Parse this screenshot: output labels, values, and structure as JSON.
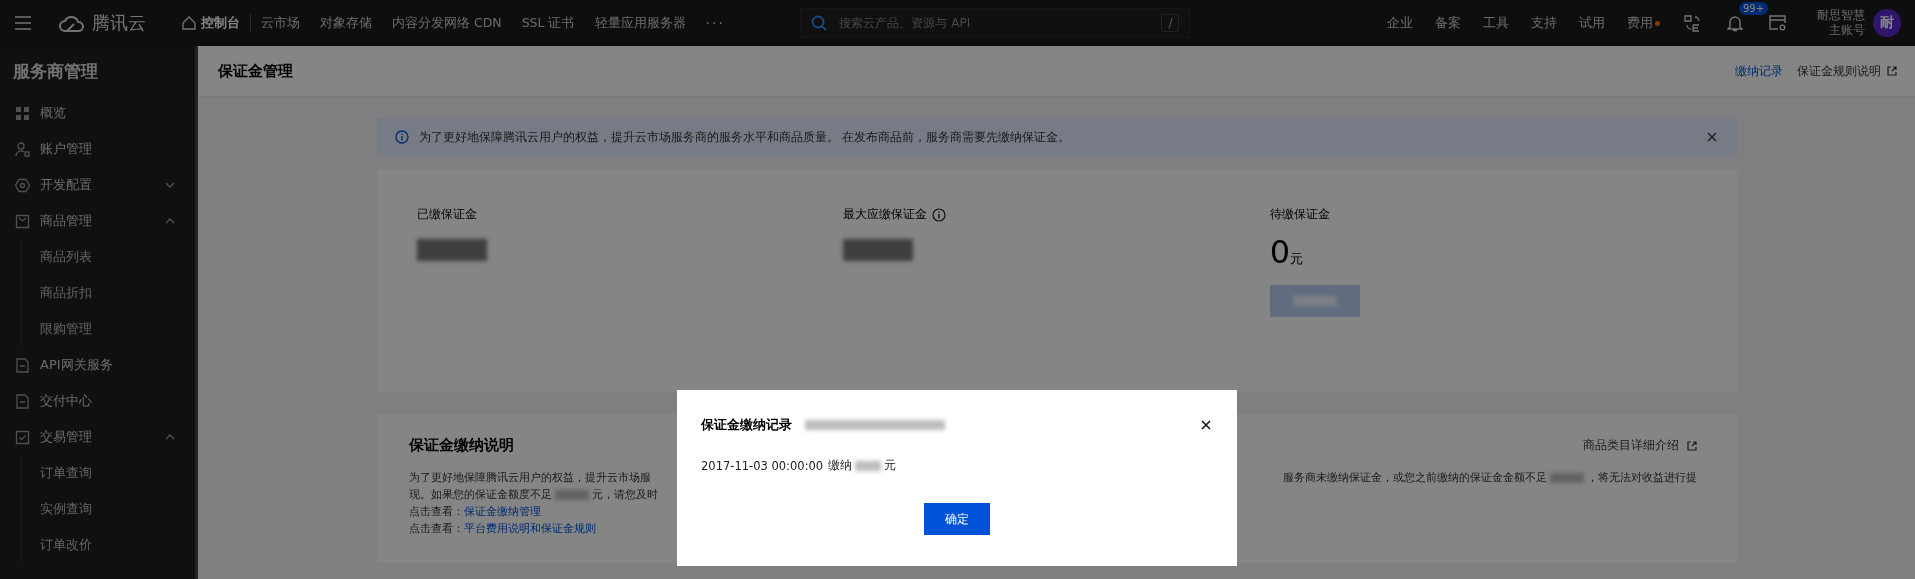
{
  "topbar": {
    "logo": "腾讯云",
    "nav": [
      {
        "label": "控制台",
        "selected": true
      },
      {
        "label": "云市场",
        "selected": false
      },
      {
        "label": "对象存储",
        "selected": false
      },
      {
        "label": "内容分发网络 CDN",
        "selected": false
      },
      {
        "label": "SSL 证书",
        "selected": false
      },
      {
        "label": "轻量应用服务器",
        "selected": false
      }
    ],
    "more": "···",
    "search": {
      "placeholder": "搜索云产品、资源与 API",
      "shortcut": "/"
    },
    "links": [
      {
        "label": "企业",
        "dot": false
      },
      {
        "label": "备案",
        "dot": false
      },
      {
        "label": "工具",
        "dot": false
      },
      {
        "label": "支持",
        "dot": false
      },
      {
        "label": "试用",
        "dot": false
      },
      {
        "label": "费用",
        "dot": true
      }
    ],
    "notifications": "99+",
    "account": {
      "name": "耐思智慧",
      "role": "主账号",
      "avatar": "耐"
    }
  },
  "sidebar": {
    "title": "服务商管理",
    "items": [
      {
        "label": "概览",
        "kind": "item"
      },
      {
        "label": "账户管理",
        "kind": "item"
      },
      {
        "label": "开发配置",
        "kind": "group",
        "expanded": false
      },
      {
        "label": "商品管理",
        "kind": "group",
        "expanded": true,
        "children": [
          {
            "label": "商品列表"
          },
          {
            "label": "商品折扣"
          },
          {
            "label": "限购管理"
          }
        ]
      },
      {
        "label": "API网关服务",
        "kind": "item"
      },
      {
        "label": "交付中心",
        "kind": "item"
      },
      {
        "label": "交易管理",
        "kind": "group",
        "expanded": true,
        "children": [
          {
            "label": "订单查询"
          },
          {
            "label": "实例查询"
          },
          {
            "label": "订单改价"
          }
        ]
      }
    ]
  },
  "page": {
    "title": "保证金管理",
    "links": [
      {
        "label": "缴纳记录",
        "kind": "primary"
      },
      {
        "label": "保证金规则说明",
        "kind": "external"
      }
    ]
  },
  "alert": {
    "text": "为了更好地保障腾讯云用户的权益，提升云市场服务商的服务水平和商品质量。 在发布商品前，服务商需要先缴纳保证金。"
  },
  "stats": [
    {
      "label": "已缴保证金",
      "kind": "redacted"
    },
    {
      "label": "最大应缴保证金",
      "kind": "redacted",
      "info": true
    },
    {
      "label": "待缴保证金",
      "kind": "amount",
      "value": "0",
      "unit": "元",
      "button": {
        "disabled": true
      }
    }
  ],
  "explain": {
    "title": "保证金缴纳说明",
    "link": "商品类目详细介绍",
    "lines": [
      [
        {
          "kind": "text",
          "text": "为了更好地保障腾讯云用户的权益，提升云市场服"
        },
        {
          "kind": "gap"
        },
        {
          "kind": "text",
          "text": "服务商未缴纳保证金，或您之前缴纳的保证金金额不足"
        },
        {
          "kind": "redacted"
        },
        {
          "kind": "text",
          "text": "，将无法对收益进行提"
        }
      ],
      [
        {
          "kind": "text",
          "text": "现。如果您的保证金额度不足"
        },
        {
          "kind": "redacted"
        },
        {
          "kind": "text",
          "text": "元，请您及时"
        }
      ]
    ],
    "refs": [
      {
        "prefix": "点击查看：",
        "link": "保证金缴纳管理"
      },
      {
        "prefix": "点击查看：",
        "link": "平台费用说明和保证金规则"
      }
    ]
  },
  "modal": {
    "title": "保证金缴纳记录",
    "record": {
      "time": "2017-11-03 00:00:00",
      "action": "缴纳",
      "unit": "元"
    },
    "button": "确定"
  }
}
